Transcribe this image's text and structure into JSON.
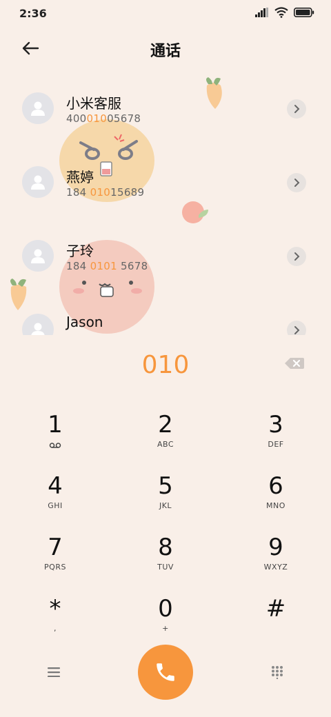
{
  "status_bar": {
    "time": "2:36"
  },
  "header": {
    "title": "通话"
  },
  "contacts": [
    {
      "name": "小米客服",
      "number_pre": "400",
      "number_hl": "010",
      "number_post": "05678"
    },
    {
      "name": "燕婷",
      "number_pre": "184 ",
      "number_hl": "010",
      "number_post": "15689"
    },
    {
      "name": "子玲",
      "number_pre": "184 ",
      "number_hl": "0101",
      "number_post": " 5678"
    },
    {
      "name": "Jason",
      "number_pre": "",
      "number_hl": "",
      "number_post": ""
    }
  ],
  "dial": {
    "input": "010"
  },
  "keys": [
    {
      "digit": "1",
      "letters": ""
    },
    {
      "digit": "2",
      "letters": "ABC"
    },
    {
      "digit": "3",
      "letters": "DEF"
    },
    {
      "digit": "4",
      "letters": "GHI"
    },
    {
      "digit": "5",
      "letters": "JKL"
    },
    {
      "digit": "6",
      "letters": "MNO"
    },
    {
      "digit": "7",
      "letters": "PQRS"
    },
    {
      "digit": "8",
      "letters": "TUV"
    },
    {
      "digit": "9",
      "letters": "WXYZ"
    },
    {
      "digit": "*",
      "letters": ","
    },
    {
      "digit": "0",
      "letters": "+"
    },
    {
      "digit": "#",
      "letters": ""
    }
  ],
  "colors": {
    "accent": "#f7963d",
    "background": "#f9efe8"
  },
  "icons": {
    "back": "arrow-left-icon",
    "chevron": "chevron-right-icon",
    "backspace": "backspace-icon",
    "voicemail": "voicemail-icon",
    "menu": "menu-icon",
    "call": "phone-icon",
    "keypad": "keypad-icon"
  }
}
